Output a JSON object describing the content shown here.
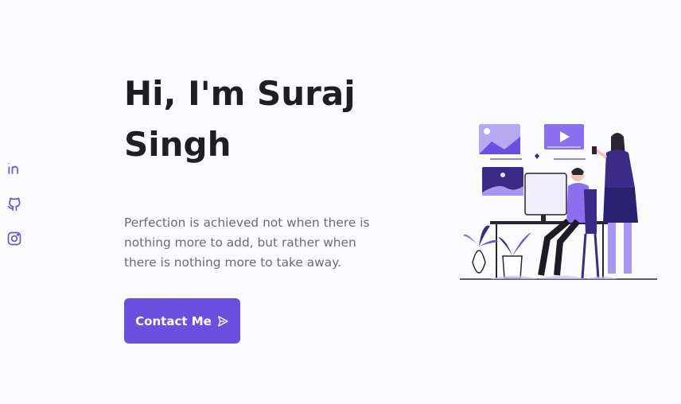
{
  "social": [
    {
      "name": "linkedin",
      "icon": "linkedin-icon"
    },
    {
      "name": "github",
      "icon": "github-icon"
    },
    {
      "name": "instagram",
      "icon": "instagram-icon"
    }
  ],
  "hero": {
    "title": "Hi, I'm Suraj Singh",
    "description": "Perfection is achieved not when there is nothing more to add, but rather when there is nothing more to take away.",
    "cta_label": "Contact Me",
    "cta_icon": "send-icon",
    "illustration": "person-at-desk-illustration"
  },
  "colors": {
    "accent": "#6a4fe0",
    "text_dark": "#1e1e24",
    "text_muted": "#6b6a73",
    "background": "#fbfbfd"
  }
}
